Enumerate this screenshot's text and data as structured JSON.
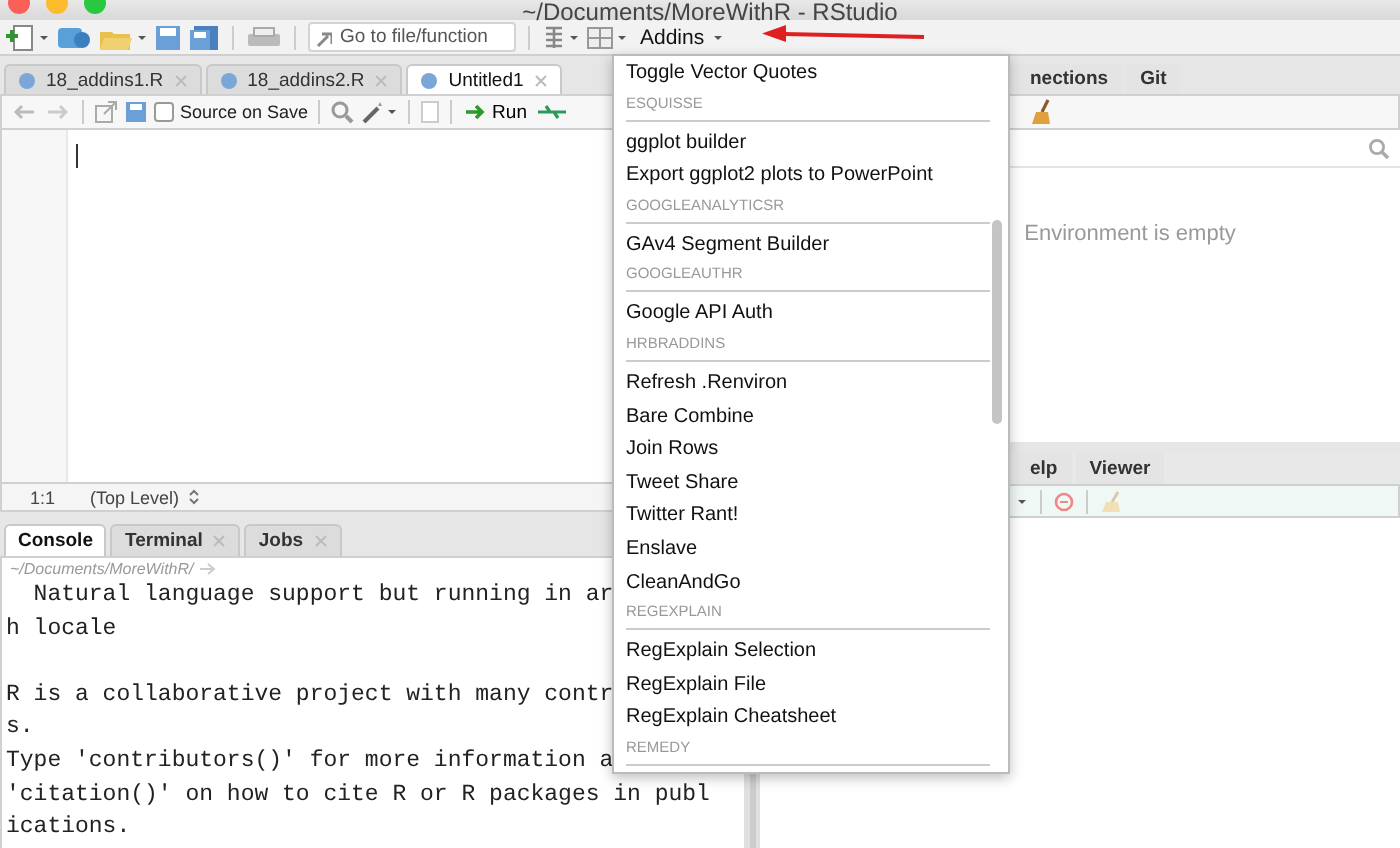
{
  "window": {
    "title": "~/Documents/MoreWithR - RStudio"
  },
  "toolbar": {
    "goto_placeholder": "Go to file/function",
    "addins_label": "Addins"
  },
  "editor": {
    "tabs": [
      {
        "label": "18_addins1.R",
        "selected": false
      },
      {
        "label": "18_addins2.R",
        "selected": false
      },
      {
        "label": "Untitled1",
        "selected": true
      }
    ],
    "source_on_save": {
      "label": "Source on Save",
      "checked": false
    },
    "run_label": "Run",
    "status": {
      "position": "1:1",
      "scope": "(Top Level)"
    }
  },
  "console": {
    "tabs": [
      {
        "label": "Console",
        "selected": true,
        "closable": false
      },
      {
        "label": "Terminal",
        "selected": false,
        "closable": true
      },
      {
        "label": "Jobs",
        "selected": false,
        "closable": true
      }
    ],
    "path": "~/Documents/MoreWithR/",
    "paragraphs": [
      [
        "  Natural language support but running in ar",
        "h locale"
      ],
      [
        "R is a collaborative project with many contr",
        "s.",
        "Type 'contributors()' for more information a",
        "'citation()' on how to cite R or R packages in publ",
        "ications."
      ]
    ]
  },
  "environment": {
    "tabs": [
      {
        "label": "nections",
        "selected": false
      },
      {
        "label": "Git",
        "selected": false
      }
    ],
    "empty_message": "Environment is empty"
  },
  "files": {
    "tabs": [
      {
        "label": "elp",
        "selected": false
      },
      {
        "label": "Viewer",
        "selected": false
      }
    ]
  },
  "addins_menu": {
    "items": [
      {
        "kind": "item",
        "label": "Toggle Vector Quotes"
      },
      {
        "kind": "header",
        "label": "ESQUISSE"
      },
      {
        "kind": "separator"
      },
      {
        "kind": "item",
        "label": "ggplot builder"
      },
      {
        "kind": "item",
        "label": "Export ggplot2 plots to PowerPoint"
      },
      {
        "kind": "header",
        "label": "GOOGLEANALYTICSR"
      },
      {
        "kind": "separator"
      },
      {
        "kind": "item",
        "label": "GAv4 Segment Builder"
      },
      {
        "kind": "header",
        "label": "GOOGLEAUTHR"
      },
      {
        "kind": "separator"
      },
      {
        "kind": "item",
        "label": "Google API Auth"
      },
      {
        "kind": "header",
        "label": "HRBRADDINS"
      },
      {
        "kind": "separator"
      },
      {
        "kind": "item",
        "label": "Refresh .Renviron"
      },
      {
        "kind": "item",
        "label": "Bare Combine"
      },
      {
        "kind": "item",
        "label": "Join Rows"
      },
      {
        "kind": "item",
        "label": "Tweet Share"
      },
      {
        "kind": "item",
        "label": "Twitter Rant!"
      },
      {
        "kind": "item",
        "label": "Enslave"
      },
      {
        "kind": "item",
        "label": "CleanAndGo"
      },
      {
        "kind": "header",
        "label": "REGEXPLAIN"
      },
      {
        "kind": "separator"
      },
      {
        "kind": "item",
        "label": "RegExplain Selection"
      },
      {
        "kind": "item",
        "label": "RegExplain File"
      },
      {
        "kind": "item",
        "label": "RegExplain Cheatsheet"
      },
      {
        "kind": "header",
        "label": "REMEDY"
      },
      {
        "kind": "separator"
      }
    ]
  }
}
